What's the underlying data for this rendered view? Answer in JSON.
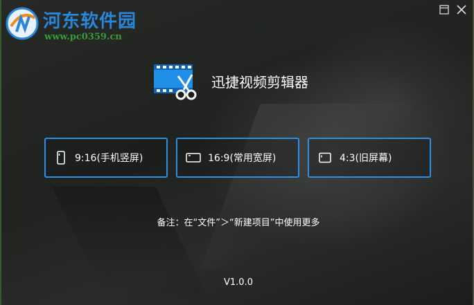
{
  "watermark": {
    "title": "河东软件园",
    "url": "www.pc0359.cn"
  },
  "window_controls": {
    "maximize_icon": "maximize-icon",
    "close_icon": "close-icon"
  },
  "app": {
    "title": "迅捷视频剪辑器",
    "icon": "video-scissors-icon",
    "accent": "#2e8fe6"
  },
  "ratios": [
    {
      "label": "9:16(手机竖屏)",
      "icon": "portrait-screen-icon"
    },
    {
      "label": "16:9(常用宽屏)",
      "icon": "widescreen-icon"
    },
    {
      "label": "4:3(旧屏幕)",
      "icon": "standard-screen-icon"
    }
  ],
  "note": "备注：在“文件”＞“新建项目”中使用更多",
  "version": "V1.0.0"
}
